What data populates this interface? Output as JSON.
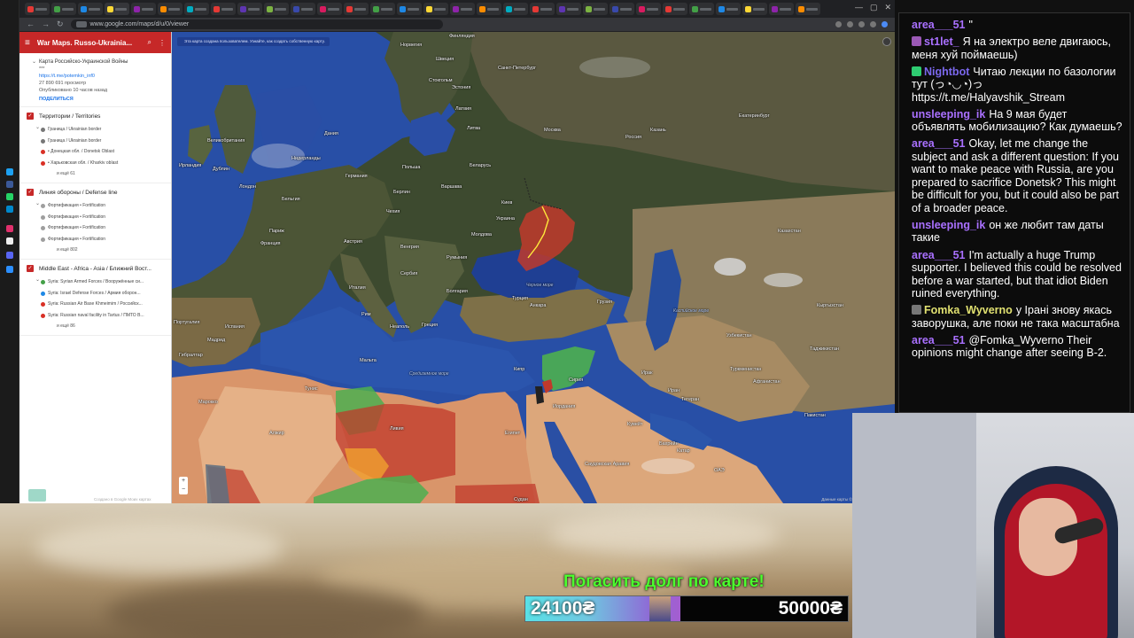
{
  "browser": {
    "url": "www.google.com/maps/d/u/0/viewer",
    "window_controls": [
      "—",
      "▢",
      "✕"
    ]
  },
  "panel": {
    "title": "War Maps. Russo-Ukrainia...",
    "map_title": "Карта Российско-Украинской Войны",
    "map_title_extra": "***",
    "link": "https://t.me/potemkin_inf0",
    "views": "27 890 691 просмотр",
    "published": "Опубликовано 10 часов назад",
    "share": "ПОДЕЛИТЬСЯ",
    "layers": [
      {
        "title": "Территории / Territories",
        "items": [
          {
            "label": "Граница / Ukrainian border",
            "color": "#777777"
          },
          {
            "label": "Граница / Ukrainian border",
            "color": "#777777"
          },
          {
            "label": "• Донецкая обл. / Donetsk Oblast",
            "color": "#d93025"
          },
          {
            "label": "• Харьковская обл. / Kharkiv oblast",
            "color": "#d93025"
          }
        ],
        "more": "и ещё 61"
      },
      {
        "title": "Линия обороны / Defense line",
        "items": [
          {
            "label": "Фортификация • Fortification",
            "color": "#9e9e9e"
          },
          {
            "label": "Фортификация • Fortification",
            "color": "#9e9e9e"
          },
          {
            "label": "Фортификация • Fortification",
            "color": "#9e9e9e"
          },
          {
            "label": "Фортификация • Fortification",
            "color": "#9e9e9e"
          }
        ],
        "more": "и ещё 802"
      },
      {
        "title": "Middle East - Africa - Asia / Ближний Вост...",
        "items": [
          {
            "label": "Syria: Syrian Armed Forces / Вооружённые си...",
            "color": "#43a047"
          },
          {
            "label": "Syria: Israel Defense Forces / Армия оборон...",
            "color": "#1e88e5"
          },
          {
            "label": "Syria: Russian Air Base Khmeimim / Российск...",
            "color": "#d93025"
          },
          {
            "label": "Syria: Russian naval facility in Tartus / ПМТО В...",
            "color": "#d93025"
          }
        ],
        "more": "и ещё 86"
      }
    ],
    "footer": "Создано в Google Моих картах"
  },
  "map": {
    "notice": "Эта карта создана пользователем. Узнайте, как создать собственную карту.",
    "footer": "Данные карты ©2025 Google  Условия",
    "labels": [
      {
        "text": "Финляндия"
      },
      {
        "text": "Норвегия"
      },
      {
        "text": "Швеция"
      },
      {
        "text": "Санкт-Петербург"
      },
      {
        "text": "Стокгольм"
      },
      {
        "text": "Эстония"
      },
      {
        "text": "Латвия"
      },
      {
        "text": "Литва"
      },
      {
        "text": "Великобритания"
      },
      {
        "text": "Ирландия"
      },
      {
        "text": "Дания"
      },
      {
        "text": "Нидерланды"
      },
      {
        "text": "Германия"
      },
      {
        "text": "Польша"
      },
      {
        "text": "Беларусь"
      },
      {
        "text": "Москва"
      },
      {
        "text": "Россия"
      },
      {
        "text": "Казань"
      },
      {
        "text": "Екатеринбург"
      },
      {
        "text": "Бельгия"
      },
      {
        "text": "Чехия"
      },
      {
        "text": "Франция"
      },
      {
        "text": "Украина"
      },
      {
        "text": "Киев"
      },
      {
        "text": "Молдова"
      },
      {
        "text": "Румыния"
      },
      {
        "text": "Венгрия"
      },
      {
        "text": "Австрия"
      },
      {
        "text": "Италия"
      },
      {
        "text": "Испания"
      },
      {
        "text": "Португалия"
      },
      {
        "text": "Сербия"
      },
      {
        "text": "Болгария"
      },
      {
        "text": "Греция"
      },
      {
        "text": "Турция"
      },
      {
        "text": "Анкара"
      },
      {
        "text": "Грузия"
      },
      {
        "text": "Казахстан"
      },
      {
        "text": "Узбекистан"
      },
      {
        "text": "Туркменистан"
      },
      {
        "text": "Кыргызстан"
      },
      {
        "text": "Таджикистан"
      },
      {
        "text": "Афганистан"
      },
      {
        "text": "Пакистан"
      },
      {
        "text": "Иран"
      },
      {
        "text": "Ирак"
      },
      {
        "text": "Сирия"
      },
      {
        "text": "Иордания"
      },
      {
        "text": "Кувейт"
      },
      {
        "text": "Тегеран"
      },
      {
        "text": "Египет"
      },
      {
        "text": "Ливия"
      },
      {
        "text": "Алжир"
      },
      {
        "text": "Тунис"
      },
      {
        "text": "Марокко"
      },
      {
        "text": "Мальта"
      },
      {
        "text": "Кипр"
      },
      {
        "text": "Бахрейн"
      },
      {
        "text": "Катар"
      },
      {
        "text": "ОАЭ"
      },
      {
        "text": "Судан"
      },
      {
        "text": "Саудовская Аравия"
      },
      {
        "text": "Гибралтар"
      },
      {
        "text": "Мадрид"
      },
      {
        "text": "Рим"
      },
      {
        "text": "Неаполь"
      },
      {
        "text": "Париж"
      },
      {
        "text": "Берлин"
      },
      {
        "text": "Варшава"
      },
      {
        "text": "Лондон"
      },
      {
        "text": "Дублин"
      },
      {
        "text": "Черное море"
      },
      {
        "text": "Каспийское море"
      },
      {
        "text": "Средиземное море"
      }
    ]
  },
  "chat": {
    "messages": [
      {
        "user": "area___51",
        "color": "#a970ff",
        "badge": "",
        "text": "\""
      },
      {
        "user": "st1let_",
        "color": "#a970ff",
        "badge": "#9b59b6",
        "text": "Я на электро веле двигаюсь, меня хуй поймаешь)"
      },
      {
        "user": "Nightbot",
        "color": "#7b68ee",
        "badge": "#2ecc71",
        "text": "Читаю лекции по базологии тут (っ◔◡◔)っ https://t.me/Halyavshik_Stream"
      },
      {
        "user": "unsleeping_ik",
        "color": "#a970ff",
        "badge": "",
        "text": "На 9 мая будет объявлять мобилизацию? Как думаешь?"
      },
      {
        "user": "area___51",
        "color": "#a970ff",
        "badge": "",
        "text": "Okay, let me change the subject and ask a different question: If you want to make peace with Russia, are you prepared to sacrifice Donetsk? This might be difficult for you, but it could also be part of a broader peace."
      },
      {
        "user": "unsleeping_ik",
        "color": "#a970ff",
        "badge": "",
        "text": "он же любит там даты такие"
      },
      {
        "user": "area___51",
        "color": "#a970ff",
        "badge": "",
        "text": "I'm actually a huge Trump supporter. I believed this could be resolved before a war started, but that idiot Biden ruined everything."
      },
      {
        "user": "Fomka_Wyverno",
        "color": "#e0e070",
        "badge": "#777777",
        "text": "у Ірані знову якась заворушка, але поки не така масштабна"
      },
      {
        "user": "area___51",
        "color": "#a970ff",
        "badge": "",
        "text": "@Fomka_Wyverno Their opinions might change after seeing B-2."
      }
    ]
  },
  "donation": {
    "title": "Погасить долг по карте!",
    "current": "24100₴",
    "goal": "50000₴",
    "progress": 0.482
  },
  "colors": {
    "occupied": "#c0392b",
    "syria_zone": "#4caf50",
    "desert": "#e2a47a",
    "sea": "#284fa6",
    "accent_green": "#4dff2e"
  }
}
